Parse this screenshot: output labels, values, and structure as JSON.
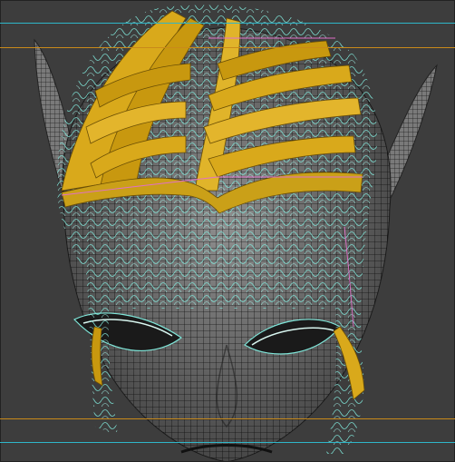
{
  "viewport": {
    "background": "#3d3d3d",
    "skin_color": "#9a9a9a",
    "wire_color": "#1a1a1a",
    "hair_color": "#d9a91b",
    "hair_dark": "#8a6a08",
    "guide_hair_color": "#7fe6d9",
    "cyan_guide": "#2fb6c8",
    "orange_guide": "#c98a1a",
    "pink_line": "#e070c8"
  }
}
